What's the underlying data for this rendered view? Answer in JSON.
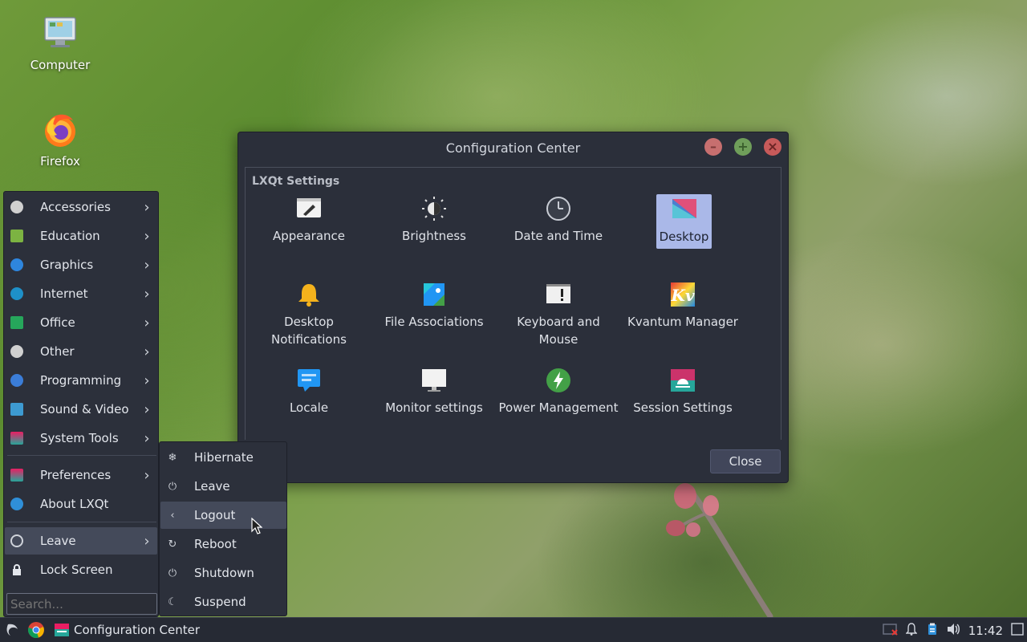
{
  "desktop": {
    "icons": [
      {
        "label": "Computer",
        "icon": "computer-icon"
      },
      {
        "label": "Firefox",
        "icon": "firefox-icon"
      }
    ]
  },
  "config_window": {
    "title": "Configuration Center",
    "section": "LXQt Settings",
    "items": [
      {
        "label": "Appearance",
        "icon": "appearance-icon"
      },
      {
        "label": "Brightness",
        "icon": "brightness-icon"
      },
      {
        "label": "Date and Time",
        "icon": "clock-icon"
      },
      {
        "label": "Desktop",
        "icon": "desktop-icon",
        "selected": true
      },
      {
        "label": "Desktop Notifications",
        "icon": "bell-icon"
      },
      {
        "label": "File Associations",
        "icon": "file-associations-icon"
      },
      {
        "label": "Keyboard and Mouse",
        "icon": "keyboard-icon"
      },
      {
        "label": "Kvantum Manager",
        "icon": "kvantum-icon"
      },
      {
        "label": "Locale",
        "icon": "locale-icon"
      },
      {
        "label": "Monitor settings",
        "icon": "monitor-icon"
      },
      {
        "label": "Power Management",
        "icon": "power-management-icon"
      },
      {
        "label": "Session Settings",
        "icon": "session-icon"
      }
    ],
    "close_label": "Close"
  },
  "start_menu": {
    "categories": [
      {
        "label": "Accessories",
        "icon": "accessories-icon",
        "color": "#d0d0d0"
      },
      {
        "label": "Education",
        "icon": "education-icon",
        "color": "#7cb342"
      },
      {
        "label": "Graphics",
        "icon": "graphics-icon",
        "color": "#2e86de"
      },
      {
        "label": "Internet",
        "icon": "internet-icon",
        "color": "#1e90c8"
      },
      {
        "label": "Office",
        "icon": "office-icon",
        "color": "#26a65b"
      },
      {
        "label": "Other",
        "icon": "other-icon",
        "color": "#d0d0d0"
      },
      {
        "label": "Programming",
        "icon": "programming-icon",
        "color": "#3b7dd8"
      },
      {
        "label": "Sound & Video",
        "icon": "sound-video-icon",
        "color": "#3d9ad1"
      },
      {
        "label": "System Tools",
        "icon": "system-tools-icon",
        "color": "#3aa7b0"
      }
    ],
    "preferences": {
      "label": "Preferences",
      "icon": "preferences-icon"
    },
    "about": {
      "label": "About LXQt",
      "icon": "lxqt-icon"
    },
    "leave": {
      "label": "Leave",
      "icon": "power-icon"
    },
    "lock": {
      "label": "Lock Screen",
      "icon": "lock-icon"
    },
    "search_placeholder": "Search..."
  },
  "leave_menu": {
    "items": [
      {
        "label": "Hibernate",
        "icon": "hibernate-icon"
      },
      {
        "label": "Leave",
        "icon": "power-icon"
      },
      {
        "label": "Logout",
        "icon": "logout-icon",
        "active": true
      },
      {
        "label": "Reboot",
        "icon": "reboot-icon"
      },
      {
        "label": "Shutdown",
        "icon": "shutdown-icon"
      },
      {
        "label": "Suspend",
        "icon": "suspend-icon"
      }
    ]
  },
  "taskbar": {
    "task_label": "Configuration Center",
    "clock": "11:42"
  }
}
